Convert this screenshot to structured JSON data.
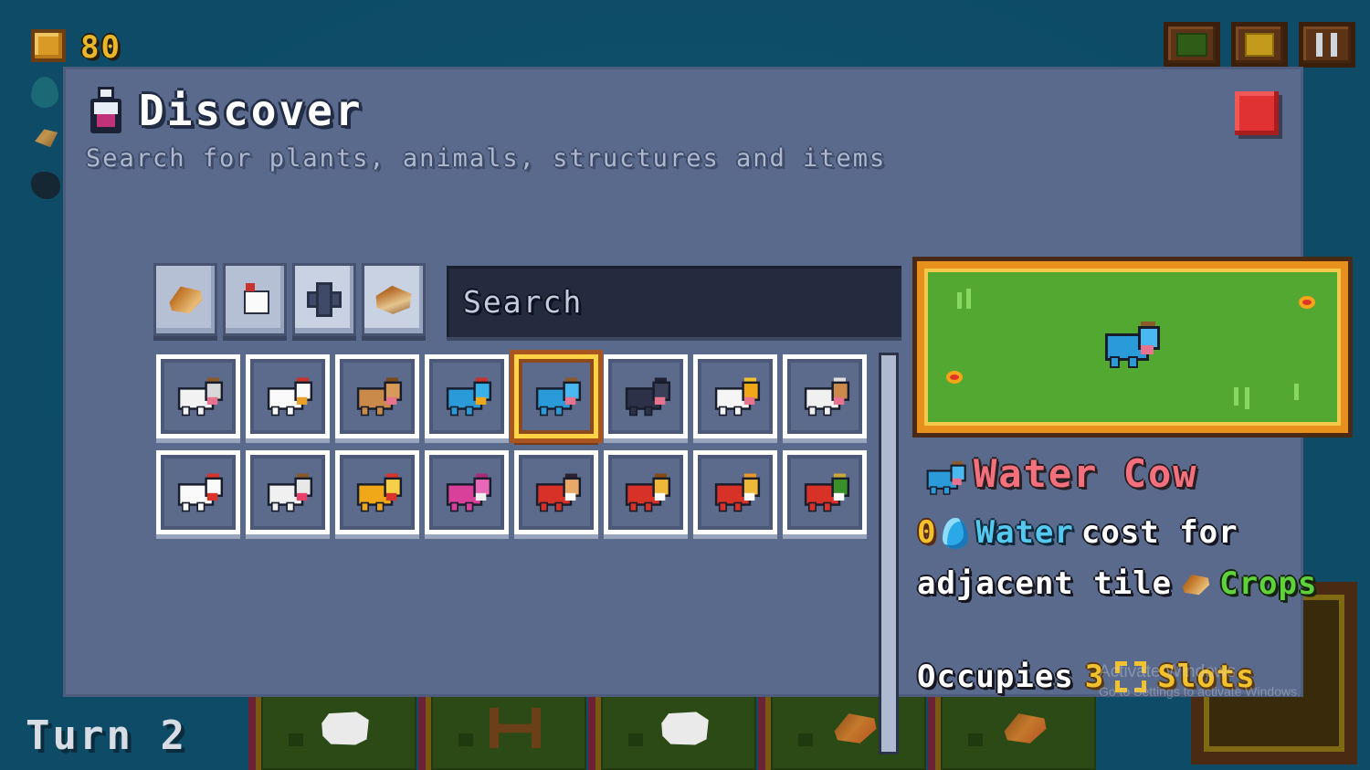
{
  "hud": {
    "coins": "80",
    "turn_label": "Turn 2",
    "resources": [
      {
        "name": "coins",
        "value": "80",
        "icon": "coin-icon"
      },
      {
        "name": "water",
        "value": "",
        "icon": "water-drop-icon"
      },
      {
        "name": "crops",
        "value": "",
        "icon": "crop-icon"
      },
      {
        "name": "coal",
        "value": "",
        "icon": "coal-icon"
      }
    ],
    "top_right_buttons": [
      {
        "name": "map-button",
        "icon": "map-icon"
      },
      {
        "name": "inventory-button",
        "icon": "chest-icon"
      },
      {
        "name": "tools-button",
        "icon": "tools-icon"
      }
    ]
  },
  "modal": {
    "title": "Discover",
    "subtitle": "Search for plants, animals, structures and items",
    "title_icon": "flask-icon",
    "close_label": ""
  },
  "filters": [
    {
      "label": "",
      "icon": "crop-icon",
      "name": "filter-plants",
      "active": false
    },
    {
      "label": "",
      "icon": "chicken-icon",
      "name": "filter-animals",
      "active": false
    },
    {
      "label": "",
      "icon": "structure-icon",
      "name": "filter-structures",
      "active": true
    },
    {
      "label": "",
      "icon": "wood-icon",
      "name": "filter-items",
      "active": false
    }
  ],
  "search": {
    "value": "",
    "placeholder": "Search"
  },
  "grid": {
    "items": [
      {
        "name": "cow",
        "selected": false,
        "body": "#f2f2f2",
        "head": "#d8d8d8",
        "accent": "#e8738f",
        "horn": "#8a5a2a"
      },
      {
        "name": "chicken",
        "selected": false,
        "body": "#fafafa",
        "head": "#fafafa",
        "accent": "#e8a12a",
        "horn": "#c8332d"
      },
      {
        "name": "brown-cow",
        "selected": false,
        "body": "#c98a4a",
        "head": "#d89a58",
        "accent": "#e8738f",
        "horn": "#7a4a1c"
      },
      {
        "name": "blue-chicken",
        "selected": false,
        "body": "#2a9ad8",
        "head": "#38b0e8",
        "accent": "#f0a818",
        "horn": "#c8332d"
      },
      {
        "name": "water-cow",
        "selected": true,
        "body": "#2a9ad8",
        "head": "#4ab8f0",
        "accent": "#e8738f",
        "horn": "#8a5a2a"
      },
      {
        "name": "night-cow",
        "selected": false,
        "body": "#2c3148",
        "head": "#3a4058",
        "accent": "#e8738f",
        "horn": "#1e2234"
      },
      {
        "name": "golden-cow",
        "selected": false,
        "body": "#f5f5f5",
        "head": "#f0a818",
        "accent": "#e8738f",
        "horn": "#f2c22e"
      },
      {
        "name": "highland-cow",
        "selected": false,
        "body": "#f0f0f0",
        "head": "#c98a4a",
        "accent": "#e8738f",
        "horn": "#e0e0e0"
      },
      {
        "name": "rooster",
        "selected": false,
        "body": "#fafafa",
        "head": "#fafafa",
        "accent": "#d8342c",
        "horn": "#d8342c"
      },
      {
        "name": "spotted-cow",
        "selected": false,
        "body": "#f0f0f0",
        "head": "#e8e8e8",
        "accent": "#e8426a",
        "horn": "#8a5a2a"
      },
      {
        "name": "chick",
        "selected": false,
        "body": "#f0a818",
        "head": "#f8d048",
        "accent": "#d8342c",
        "horn": "#d8342c"
      },
      {
        "name": "pink-block",
        "selected": false,
        "body": "#d8409a",
        "head": "#e868b8",
        "accent": "#f0f0f0",
        "horn": "#a82a78"
      },
      {
        "name": "small-crab",
        "selected": false,
        "body": "#d83228",
        "head": "#e8a868",
        "accent": "#ffffff",
        "horn": "#2a2230"
      },
      {
        "name": "crab",
        "selected": false,
        "body": "#d83228",
        "head": "#f0b838",
        "accent": "#ffffff",
        "horn": "#8a4a14"
      },
      {
        "name": "king-crab",
        "selected": false,
        "body": "#d83228",
        "head": "#f0b838",
        "accent": "#ffffff",
        "horn": "#e89828"
      },
      {
        "name": "green-crab",
        "selected": false,
        "body": "#d83228",
        "head": "#3a9028",
        "accent": "#ffffff",
        "horn": "#c8a838"
      }
    ]
  },
  "scrollbar": {
    "position": "top",
    "name": "grid-scrollbar"
  },
  "detail": {
    "name": "Water Cow",
    "name_color": "#f4707c",
    "preview": {
      "background_color": "#53a832",
      "frame_color": "#e8901e",
      "flowers": 2,
      "grass_tufts": 3
    },
    "cost_number": "0",
    "cost_resource": "Water",
    "cost_resource_color": "#55c8f0",
    "cost_text_1": "cost for",
    "cost_text_2": "adjacent tile",
    "cost_target": "Crops",
    "cost_target_color": "#5fd13a",
    "slots_label": "Occupies",
    "slots_count": "3",
    "slots_suffix": "Slots",
    "slots_color": "#f2c22e"
  },
  "board": {
    "tiles": [
      {
        "name": "tile-cow",
        "content": "cow"
      },
      {
        "name": "tile-fence",
        "content": "fence"
      },
      {
        "name": "tile-cow-2",
        "content": "cow"
      },
      {
        "name": "tile-crop",
        "content": "crop"
      },
      {
        "name": "tile-crop-2",
        "content": "crop"
      }
    ]
  },
  "watermark": {
    "title": "Activate Windows",
    "subtitle": "Go to Settings to activate Windows."
  }
}
